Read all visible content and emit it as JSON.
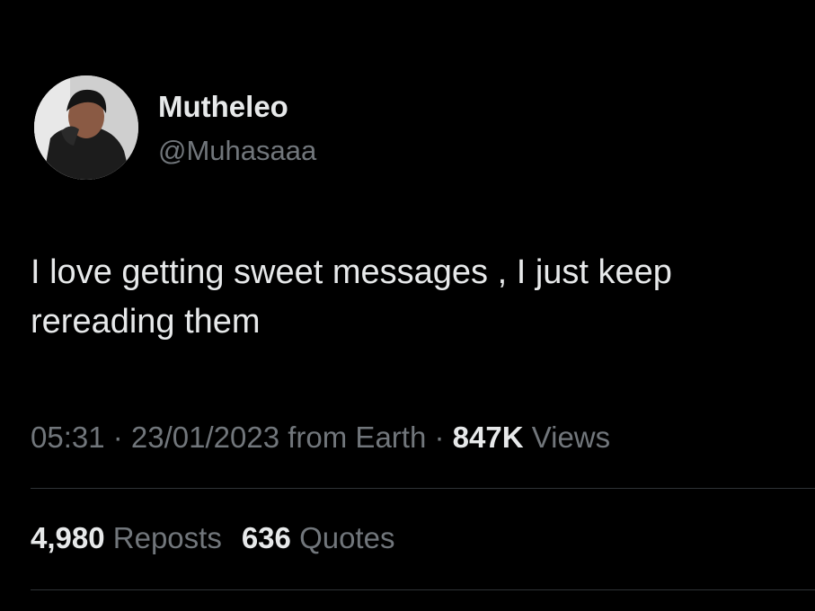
{
  "user": {
    "display_name": "Mutheleo",
    "handle": "@Muhasaaa",
    "avatar_icon": "profile-photo"
  },
  "tweet": {
    "lines": [
      "I love getting sweet messages , I just keep",
      "rereading them"
    ]
  },
  "meta": {
    "time": "05:31",
    "separator": " · ",
    "date": "23/01/2023",
    "source": "from Earth",
    "views_count": "847K",
    "views_label": "Views"
  },
  "stats": {
    "reposts_count": "4,980",
    "reposts_label": "Reposts",
    "quotes_count": "636",
    "quotes_label": "Quotes"
  },
  "colors": {
    "background": "#000000",
    "primary_text": "#e7e9ea",
    "secondary_text": "#71767b",
    "divider": "#2f3336"
  }
}
